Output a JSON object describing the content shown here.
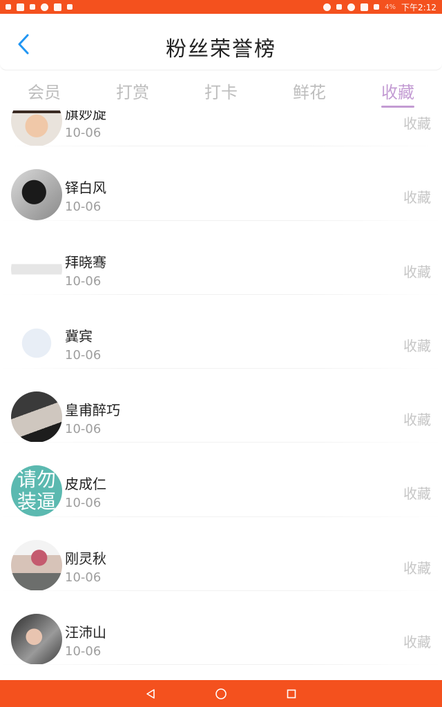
{
  "status_bar": {
    "battery_percent": "4%",
    "time": "下午2:12"
  },
  "header": {
    "title": "粉丝荣誉榜"
  },
  "tabs": [
    {
      "label": "会员",
      "active": false
    },
    {
      "label": "打赏",
      "active": false
    },
    {
      "label": "打卡",
      "active": false
    },
    {
      "label": "鲜花",
      "active": false
    },
    {
      "label": "收藏",
      "active": true
    }
  ],
  "list": {
    "items": [
      {
        "name": "旗妙旋",
        "date": "10-06",
        "action": "收藏"
      },
      {
        "name": "铎白风",
        "date": "10-06",
        "action": "收藏"
      },
      {
        "name": "拜晓骞",
        "date": "10-06",
        "action": "收藏"
      },
      {
        "name": "冀宾",
        "date": "10-06",
        "action": "收藏"
      },
      {
        "name": "皇甫醉巧",
        "date": "10-06",
        "action": "收藏"
      },
      {
        "name": "皮成仁",
        "date": "10-06",
        "action": "收藏"
      },
      {
        "name": "刚灵秋",
        "date": "10-06",
        "action": "收藏"
      },
      {
        "name": "汪沛山",
        "date": "10-06",
        "action": "收藏"
      }
    ]
  },
  "avatar_text": {
    "item_6": "请勿装逼"
  },
  "colors": {
    "accent": "#f4511e",
    "active_tab": "#c39bd3",
    "back_arrow": "#2196f3"
  }
}
